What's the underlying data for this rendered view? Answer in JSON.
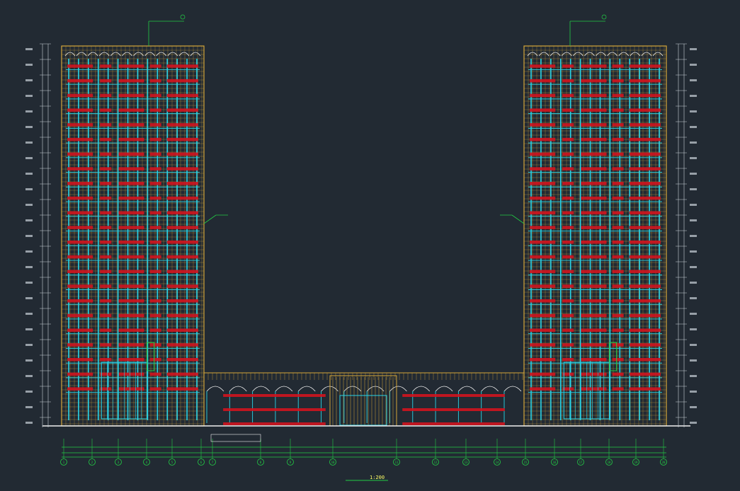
{
  "colors": {
    "background": "#222a33",
    "frame": "#d4a53a",
    "window_glass": "#29d3e6",
    "balcony": "#d0141e",
    "annotation": "#22cc44",
    "dimension": "#c9d1d9",
    "white_line": "#f0f0f0"
  },
  "drawing": {
    "title": "",
    "scale": "1:200",
    "left_tower_note": "",
    "right_tower_note": "",
    "podium_note_left": "",
    "podium_note_right": ""
  },
  "axis_labels": [
    "1",
    "2",
    "3",
    "4",
    "5",
    "6",
    "7",
    "8",
    "9",
    "10",
    "11",
    "12",
    "13",
    "14",
    "15",
    "16",
    "17",
    "18",
    "19",
    "20",
    "21"
  ],
  "building": {
    "left_tower_floors": 23,
    "right_tower_floors": 23,
    "podium_floors": 3
  }
}
